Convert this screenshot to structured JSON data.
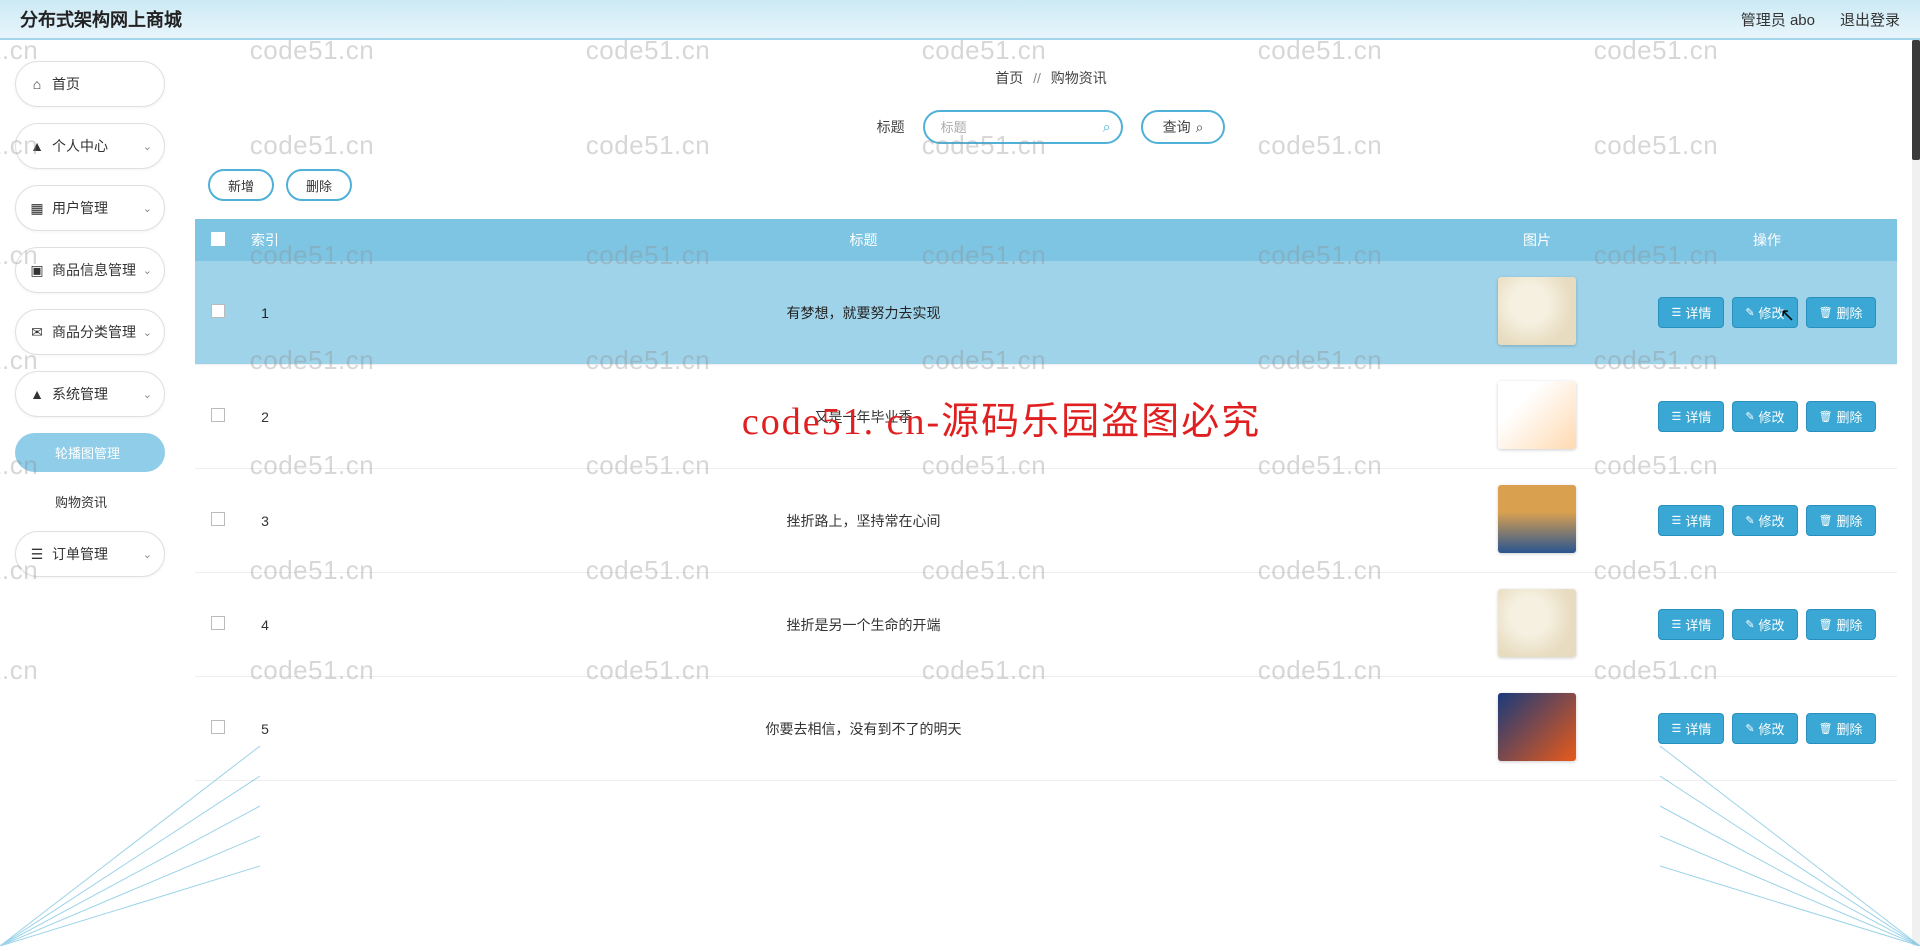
{
  "header": {
    "title": "分布式架构网上商城",
    "admin": "管理员 abo",
    "logout": "退出登录"
  },
  "watermark": "code51.cn",
  "big_watermark": "code51. cn-源码乐园盗图必究",
  "sidebar": {
    "items": [
      {
        "label": "首页",
        "icon": "home",
        "expandable": false
      },
      {
        "label": "个人中心",
        "icon": "user",
        "expandable": true
      },
      {
        "label": "用户管理",
        "icon": "grid",
        "expandable": true
      },
      {
        "label": "商品信息管理",
        "icon": "grid4",
        "expandable": true
      },
      {
        "label": "商品分类管理",
        "icon": "mail",
        "expandable": true
      },
      {
        "label": "系统管理",
        "icon": "user2",
        "expandable": true
      },
      {
        "label": "订单管理",
        "icon": "list",
        "expandable": true
      }
    ],
    "sub": [
      {
        "label": "轮播图管理",
        "active": true
      },
      {
        "label": "购物资讯",
        "active": false
      }
    ]
  },
  "breadcrumb": {
    "a": "首页",
    "sep": "//",
    "b": "购物资讯"
  },
  "search": {
    "label": "标题",
    "placeholder": "标题",
    "button": "查询"
  },
  "actions": {
    "add": "新增",
    "del": "删除"
  },
  "table": {
    "headers": {
      "idx": "索引",
      "title": "标题",
      "img": "图片",
      "op": "操作"
    },
    "ops": {
      "detail": "详情",
      "edit": "修改",
      "del": "删除"
    },
    "rows": [
      {
        "idx": "1",
        "title": "有梦想，就要努力去实现",
        "selected": true
      },
      {
        "idx": "2",
        "title": "又是一年毕业季",
        "selected": false
      },
      {
        "idx": "3",
        "title": "挫折路上，坚持常在心间",
        "selected": false
      },
      {
        "idx": "4",
        "title": "挫折是另一个生命的开端",
        "selected": false
      },
      {
        "idx": "5",
        "title": "你要去相信，没有到不了的明天",
        "selected": false
      }
    ]
  }
}
